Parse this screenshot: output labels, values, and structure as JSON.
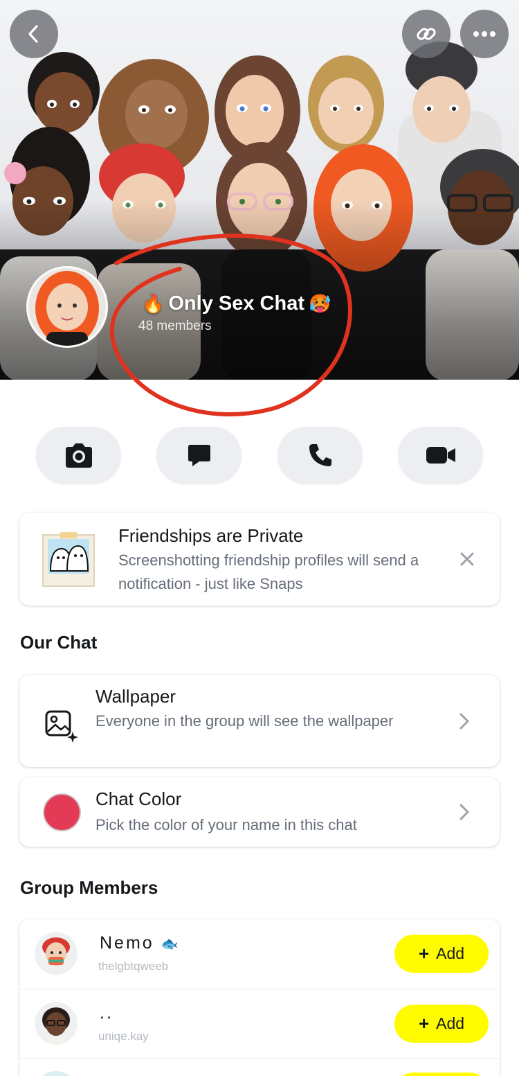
{
  "header": {
    "group_name": "Only Sex Chat",
    "leading_emoji": "🔥",
    "trailing_emoji": "🥵",
    "member_count": "48 members"
  },
  "icons": {
    "back": "chevron-left-icon",
    "link": "link-icon",
    "more": "more-horizontal-icon",
    "camera": "camera-icon",
    "chat": "chat-bubble-icon",
    "call": "phone-icon",
    "video": "video-icon"
  },
  "privacy": {
    "title": "Friendships are Private",
    "body": "Screenshotting friendship profiles will send a notification - just like Snaps"
  },
  "our_chat": {
    "heading": "Our Chat",
    "wallpaper_title": "Wallpaper",
    "wallpaper_sub": "Everyone in the group will see the wallpaper",
    "color_title": "Chat Color",
    "color_sub": "Pick the color of your name in this chat",
    "chat_color": "#e33a55"
  },
  "members": {
    "heading": "Group Members",
    "add_label": "Add",
    "add_plus": "+",
    "list": [
      {
        "name": "Nemo",
        "name_emoji": "🐟",
        "username": "thelgbtqweeb"
      },
      {
        "name": "..",
        "name_emoji": "",
        "username": "uniqe.kay"
      },
      {
        "name": "",
        "name_emoji": "",
        "username": ""
      }
    ]
  },
  "colors": {
    "accent_yellow": "#fffc00",
    "annotation_red": "#e0331f"
  }
}
